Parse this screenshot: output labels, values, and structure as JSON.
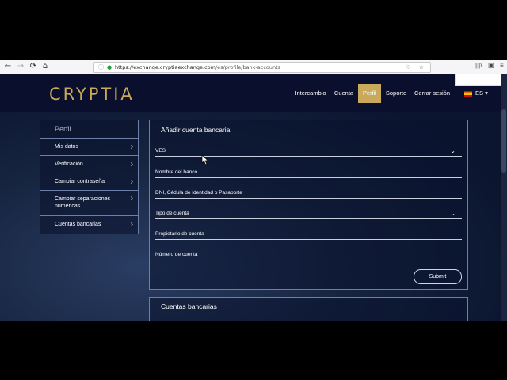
{
  "browser": {
    "back": "←",
    "forward": "→",
    "reload": "⟳",
    "home": "⌂",
    "url_host": "https://exchange.cryptiaexchange.com",
    "url_path": "/es/profile/bank-accounts",
    "info_icon": "ⓘ",
    "lock_icon": "🔒",
    "url_icons": "··· ♡ ☆",
    "library": "|||\\",
    "sidebar_toggle": "▣",
    "menu": "≡"
  },
  "header": {
    "logo": "CRYPTIA",
    "nav": [
      "Intercambio",
      "Cuenta",
      "Perfil",
      "Soporte",
      "Cerrar sesión"
    ],
    "active": "Perfil",
    "lang": "ES ▾"
  },
  "sidebar": {
    "title": "Perfil",
    "items": [
      {
        "label": "Mis datos"
      },
      {
        "label": "Verificación"
      },
      {
        "label": "Cambiar contraseña"
      },
      {
        "label": "Cambiar separaciones numéricas"
      },
      {
        "label": "Cuentas bancarias"
      }
    ],
    "chevron": "›"
  },
  "form": {
    "title": "Añadir cuenta bancaria",
    "currency": "VES",
    "bank_name": "Nombre del banco",
    "id_number": "DNI, Cédula de Identidad o Pasaporte",
    "account_type": "Tipo de cuenta",
    "owner": "Propietario de cuenta",
    "account_number": "Número de cuenta",
    "submit": "Submit",
    "dropdown_chevron": "⌄"
  },
  "accounts": {
    "title": "Cuentas bancarias"
  },
  "colors": {
    "accent": "#c9a95a",
    "header_bg": "#0a0f2d",
    "page_bg": "#0b1530",
    "border": "#6b7fa8"
  }
}
